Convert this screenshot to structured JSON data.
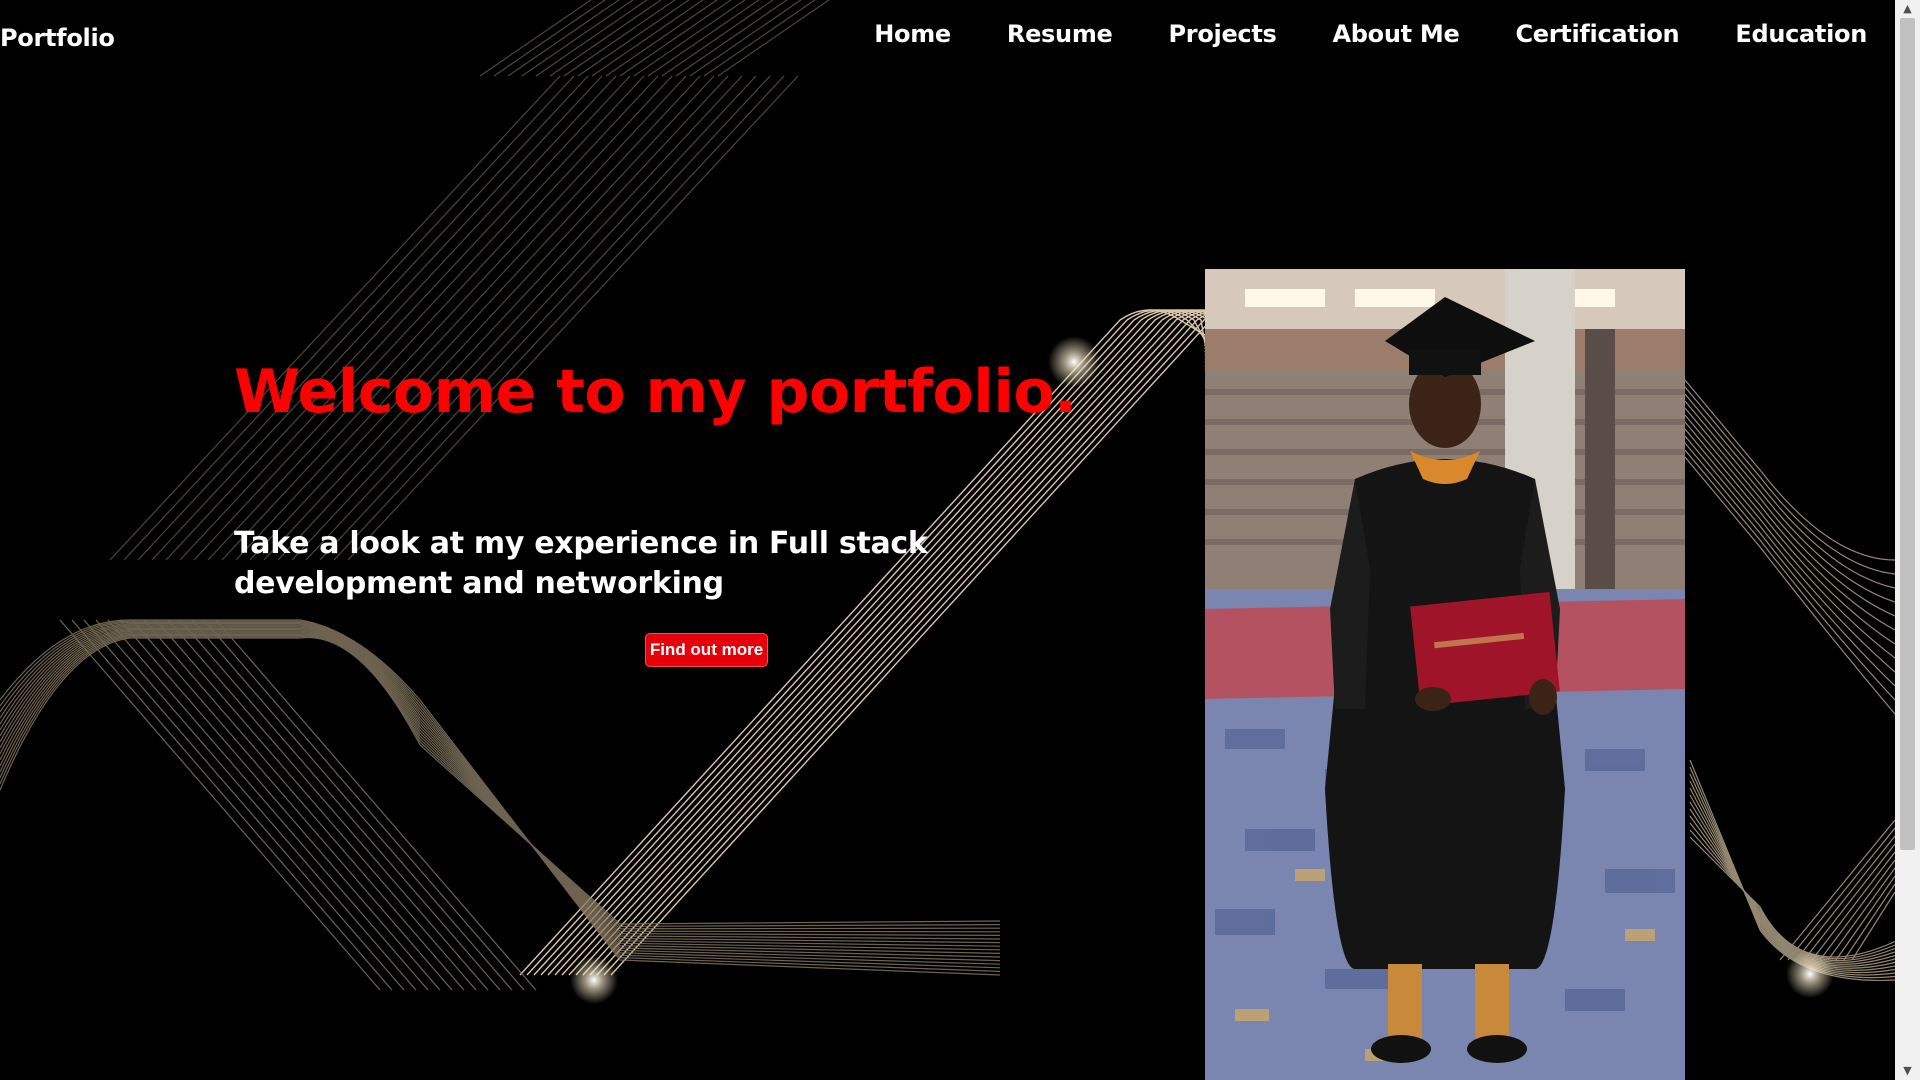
{
  "navbar": {
    "brand": "Portfolio",
    "links": [
      {
        "label": "Home"
      },
      {
        "label": "Resume"
      },
      {
        "label": "Projects"
      },
      {
        "label": "About Me"
      },
      {
        "label": "Certification"
      },
      {
        "label": "Education"
      }
    ]
  },
  "hero": {
    "title": "Welcome to my portfolio.",
    "subtitle": "Take a look at my experience in Full stack development and networking",
    "cta_label": "Find out more"
  },
  "colors": {
    "background": "#000000",
    "accent": "#ff0000",
    "text": "#ffffff",
    "line_art": "#d8c7a8"
  },
  "icons": {
    "scroll_up": "arrow-up-icon",
    "scroll_down": "arrow-down-icon"
  }
}
